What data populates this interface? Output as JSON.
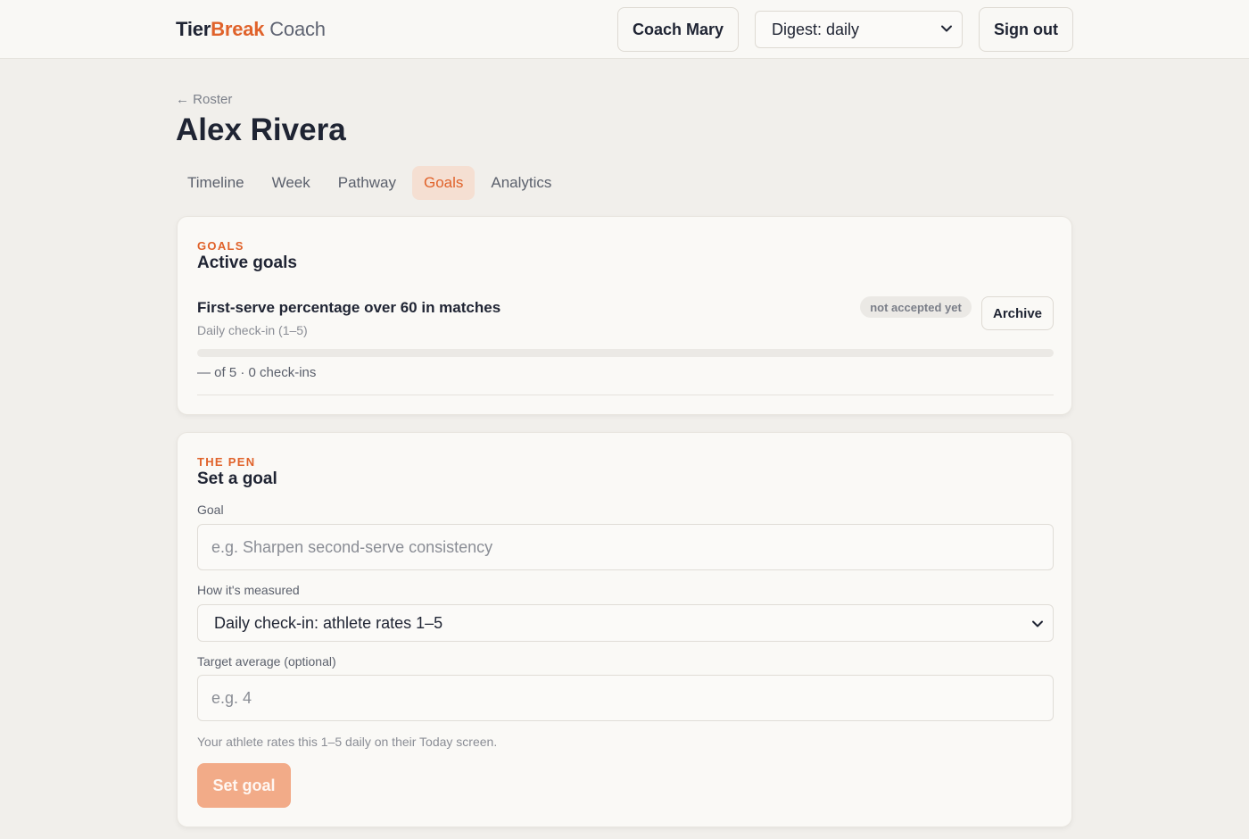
{
  "header": {
    "brand_part1": "Tier",
    "brand_part2": "Break",
    "brand_part3": "Coach",
    "coach_label": "Coach Mary",
    "digest_value": "Digest: daily",
    "signout_label": "Sign out"
  },
  "breadcrumb": {
    "label": "← Roster"
  },
  "athlete": {
    "name": "Alex Rivera"
  },
  "tabs": [
    {
      "label": "Timeline",
      "active": false
    },
    {
      "label": "Week",
      "active": false
    },
    {
      "label": "Pathway",
      "active": false
    },
    {
      "label": "Goals",
      "active": true
    },
    {
      "label": "Analytics",
      "active": false
    }
  ],
  "goals_card": {
    "eyebrow": "GOALS",
    "heading": "Active goals",
    "goal": {
      "title": "First-serve percentage over 60 in matches",
      "measure": "Daily check-in (1–5)",
      "status": "not accepted yet",
      "archive_label": "Archive",
      "progress_fraction": 0,
      "progress_text": "— of 5 · 0 check-ins"
    }
  },
  "pen_card": {
    "eyebrow": "THE PEN",
    "heading": "Set a goal",
    "goal_label": "Goal",
    "goal_placeholder": "e.g. Sharpen second-serve consistency",
    "measure_label": "How it's measured",
    "measure_value": "Daily check-in: athlete rates 1–5",
    "target_label": "Target average (optional)",
    "target_placeholder": "e.g. 4",
    "hint": "Your athlete rates this 1–5 daily on their Today screen.",
    "submit_label": "Set goal"
  },
  "colors": {
    "accent": "#e0622a",
    "accent_soft": "#f5dfd2",
    "submit_disabled": "#f2ab88",
    "background": "#f1efeb",
    "card": "#faf9f6"
  }
}
